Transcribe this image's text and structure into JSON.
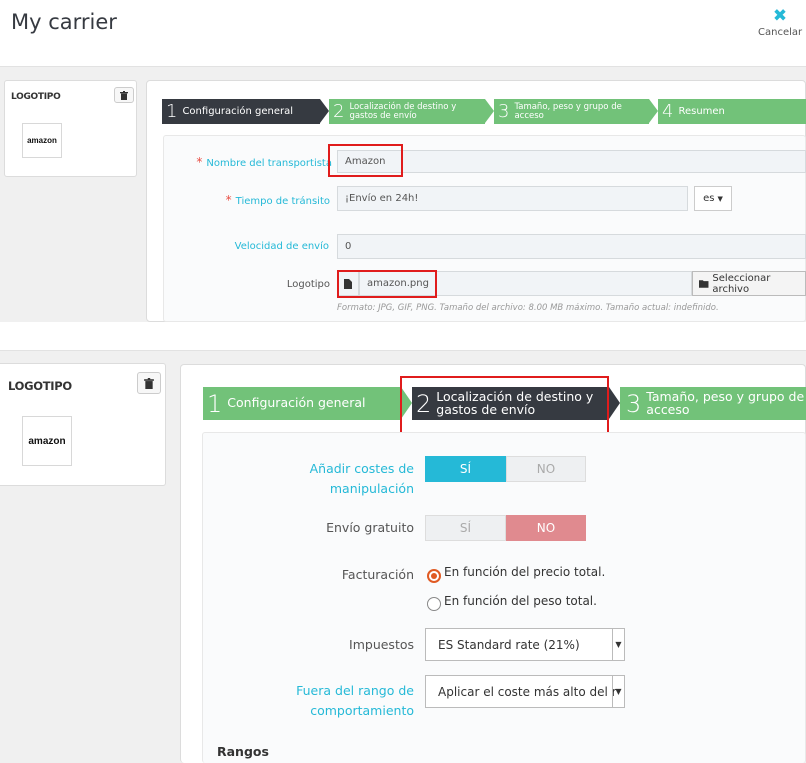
{
  "header": {
    "title": "My carrier",
    "cancel_label": "Cancelar"
  },
  "logo_card": {
    "title": "LOGOTIPO",
    "brand": "amazon"
  },
  "wizard": {
    "steps": [
      {
        "num": "1",
        "label": "Configuración general"
      },
      {
        "num": "2",
        "label": "Localización de destino y gastos de envío"
      },
      {
        "num": "3",
        "label": "Tamaño, peso y grupo de acceso"
      },
      {
        "num": "4",
        "label": "Resumen"
      }
    ]
  },
  "general_form": {
    "name_label": "Nombre del transportista",
    "name_value": "Amazon",
    "transit_label": "Tiempo de tránsito",
    "transit_value": "¡Envío en 24h!",
    "lang": "es",
    "speed_label": "Velocidad de envío",
    "speed_value": "0",
    "logo_label": "Logotipo",
    "logo_file": "amazon.png",
    "select_file_label": "Seleccionar archivo",
    "format_hint": "Formato: JPG, GIF, PNG. Tamaño del archivo: 8.00 MB máximo. Tamaño actual: indefinido."
  },
  "shipping_form": {
    "handling_label": "Añadir costes de manipulación",
    "handling_yes": "SÍ",
    "handling_no": "NO",
    "free_label": "Envío gratuito",
    "free_yes": "SÍ",
    "free_no": "NO",
    "billing_label": "Facturación",
    "billing_opt1": "En función del precio total.",
    "billing_opt2": "En función del peso total.",
    "tax_label": "Impuestos",
    "tax_value": "ES Standard rate (21%)",
    "out_of_range_label": "Fuera del rango de comportamiento",
    "out_of_range_value": "Aplicar el coste más alto del r",
    "ranges_label": "Rangos"
  },
  "colors": {
    "accent": "#25b9d7",
    "step_done": "#72c279",
    "step_active": "#363a41",
    "no_active": "#e08a8f",
    "highlight": "#e01c1c"
  }
}
